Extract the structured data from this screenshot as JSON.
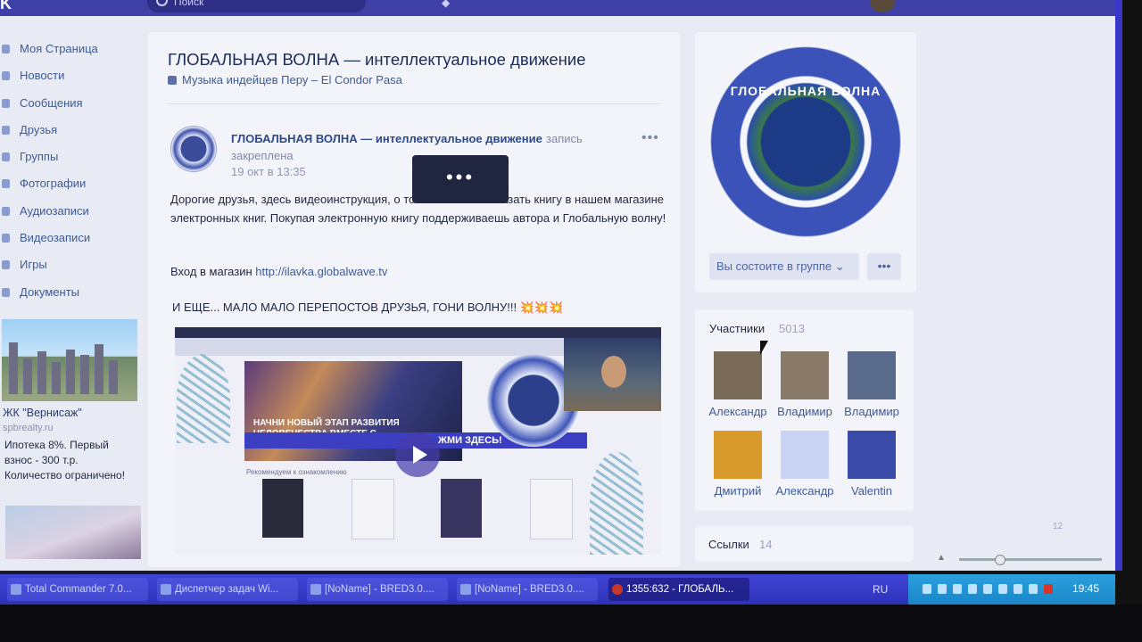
{
  "topbar": {
    "logo": "K",
    "search_placeholder": "Поиск"
  },
  "left_menu": {
    "items": [
      {
        "label": "Моя Страница",
        "icon": "home-icon"
      },
      {
        "label": "Новости",
        "icon": "news-icon"
      },
      {
        "label": "Сообщения",
        "icon": "messages-icon"
      },
      {
        "label": "Друзья",
        "icon": "friends-icon"
      },
      {
        "label": "Группы",
        "icon": "groups-icon"
      },
      {
        "label": "Фотографии",
        "icon": "photos-icon"
      },
      {
        "label": "Аудиозаписи",
        "icon": "audio-icon"
      },
      {
        "label": "Видеозаписи",
        "icon": "video-icon"
      },
      {
        "label": "Игры",
        "icon": "games-icon"
      },
      {
        "label": "Документы",
        "icon": "documents-icon"
      }
    ],
    "ad": {
      "title": "ЖК \"Вернисаж\"",
      "site": "spbrealty.ru",
      "text": "Ипотека 8%. Первый взнос - 300 т.р. Количество ограничено!"
    }
  },
  "group": {
    "title": "ГЛОБАЛЬНАЯ ВОЛНА — интеллектуальное движение",
    "status": "Музыка индейцев Перу – El Condor Pasa"
  },
  "post": {
    "author": "ГЛОБАЛЬНАЯ ВОЛНА — интеллектуальное движение",
    "author_suffix": "запись",
    "pinned": "закреплена",
    "date": "19 окт в 13:35",
    "more": "•••",
    "text": "Дорогие друзья, здесь видеоинструкция, о том как можно заказать книгу в нашем магазине электронных книг. Покупая электронную книгу поддерживаешь автора и Глобальную волну!",
    "shop_label": "Вход в магазин",
    "shop_link": "http://ilavka.globalwave.tv",
    "extra": "И ЕЩЕ... МАЛО МАЛО ПЕРЕПОСТОВ ДРУЗЬЯ, ГОНИ ВОЛНУ!!!",
    "extra_emoji": "💥💥💥",
    "loading": "•••",
    "video": {
      "poster_text": "НАЧНИ НОВЫЙ ЭТАП РАЗВИТИЯ ЧЕЛОВЕЧЕСТВА ВМЕСТЕ С ГЛОБАЛЬНОЙ ВОЛНОЙ",
      "banner_text": "ЖМИ ЗДЕСЬ!",
      "recs": "Рекомендуем к ознакомлению"
    }
  },
  "sidebar": {
    "avatar_text": "ГЛОБАЛЬНАЯ ВОЛНА",
    "join_button": "Вы состоите в группе ⌄",
    "more_button": "•••",
    "members_label": "Участники",
    "members_count": "5013",
    "members": [
      {
        "name": "Александр",
        "color": "#7a6a58"
      },
      {
        "name": "Владимир",
        "color": "#8a7a6a"
      },
      {
        "name": "Владимир",
        "color": "#5a6a8a"
      },
      {
        "name": "Дмитрий",
        "color": "#d89a2a"
      },
      {
        "name": "Александр",
        "color": "#c9d3f3"
      },
      {
        "name": "Valentin",
        "color": "#3a4ca8"
      }
    ],
    "links_label": "Ссылки",
    "links_count": "14",
    "online": "12"
  },
  "taskbar": {
    "tasks": [
      {
        "label": "Total Commander 7.0..."
      },
      {
        "label": "Диспетчер задач Wi..."
      },
      {
        "label": "[NoName] - BRED3.0...."
      },
      {
        "label": "[NoName] - BRED3.0...."
      },
      {
        "label": "1355:632 - ГЛОБАЛЬ...",
        "active": true
      }
    ],
    "lang": "RU",
    "clock": "19:45"
  },
  "colors": {
    "screen_bg": "#e9ebf4",
    "accent": "#3f3fa8",
    "link": "#3d5a96",
    "taskbar": "#3f44d6",
    "tray": "#2ba0de"
  }
}
